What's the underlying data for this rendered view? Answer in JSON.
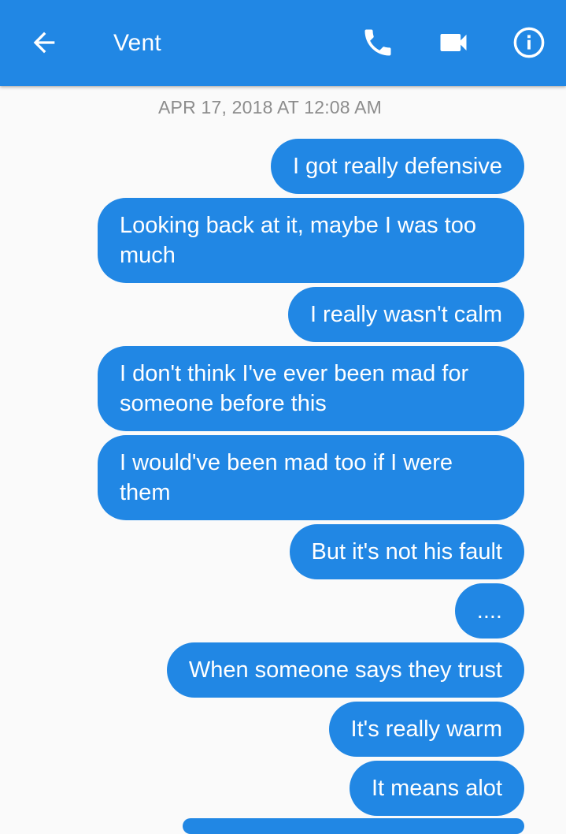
{
  "header": {
    "title": "Vent",
    "icons": [
      "back-arrow-icon",
      "phone-icon",
      "video-camera-icon",
      "info-icon"
    ],
    "background": "#2187e4"
  },
  "timestamp": "APR 17, 2018 AT 12:08 AM",
  "messages": [
    {
      "text": "I got really defensive",
      "sender": "me"
    },
    {
      "text": "Looking back at it, maybe I was too much",
      "sender": "me"
    },
    {
      "text": "I really wasn't calm",
      "sender": "me"
    },
    {
      "text": "I don't think I've ever been mad for someone before this",
      "sender": "me"
    },
    {
      "text": "I would've been mad too if I were them",
      "sender": "me"
    },
    {
      "text": "But it's not his fault",
      "sender": "me"
    },
    {
      "text": "....",
      "sender": "me"
    },
    {
      "text": "When someone says they trust",
      "sender": "me"
    },
    {
      "text": "It's really warm",
      "sender": "me"
    },
    {
      "text": "It means alot",
      "sender": "me"
    }
  ],
  "colors": {
    "bubble": "#2187e4",
    "background": "#fafafa",
    "timestamp": "#8c8c8c"
  }
}
